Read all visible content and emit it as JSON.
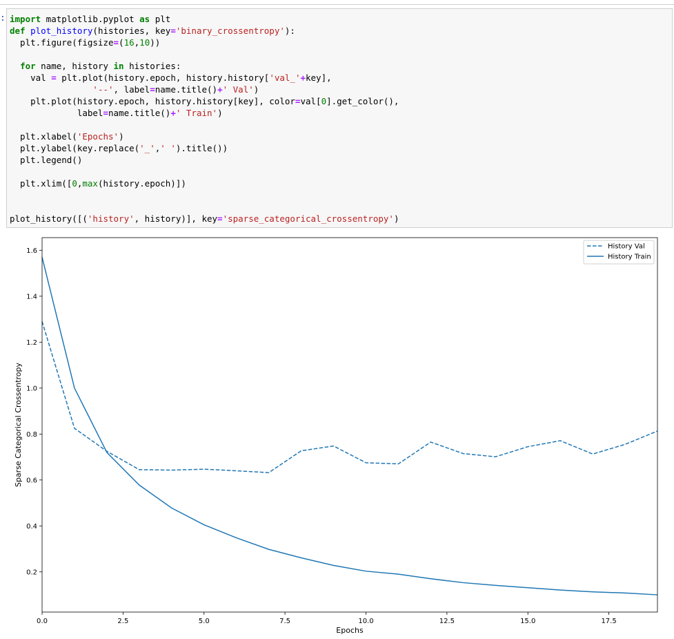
{
  "notebook": {
    "prompt": ":",
    "code_lines": [
      [
        {
          "t": "import",
          "c": "kw"
        },
        {
          "t": " matplotlib.pyplot "
        },
        {
          "t": "as",
          "c": "kw"
        },
        {
          "t": " plt"
        }
      ],
      [
        {
          "t": "def",
          "c": "kw"
        },
        {
          "t": " "
        },
        {
          "t": "plot_history",
          "c": "fn"
        },
        {
          "t": "(histories, key"
        },
        {
          "t": "=",
          "c": "op"
        },
        {
          "t": "'binary_crossentropy'",
          "c": "str"
        },
        {
          "t": "):"
        }
      ],
      [
        {
          "t": "  plt.figure(figsize"
        },
        {
          "t": "=",
          "c": "op"
        },
        {
          "t": "("
        },
        {
          "t": "16",
          "c": "num"
        },
        {
          "t": ","
        },
        {
          "t": "10",
          "c": "num"
        },
        {
          "t": "))"
        }
      ],
      [],
      [
        {
          "t": "  "
        },
        {
          "t": "for",
          "c": "kw"
        },
        {
          "t": " name, history "
        },
        {
          "t": "in",
          "c": "kw"
        },
        {
          "t": " histories:"
        }
      ],
      [
        {
          "t": "    val "
        },
        {
          "t": "=",
          "c": "op"
        },
        {
          "t": " plt.plot(history.epoch, history.history["
        },
        {
          "t": "'val_'",
          "c": "str"
        },
        {
          "t": "+",
          "c": "op"
        },
        {
          "t": "key],"
        }
      ],
      [
        {
          "t": "                "
        },
        {
          "t": "'--'",
          "c": "str"
        },
        {
          "t": ", label"
        },
        {
          "t": "=",
          "c": "op"
        },
        {
          "t": "name.title()"
        },
        {
          "t": "+",
          "c": "op"
        },
        {
          "t": "' Val'",
          "c": "str"
        },
        {
          "t": ")"
        }
      ],
      [
        {
          "t": "    plt.plot(history.epoch, history.history[key], color"
        },
        {
          "t": "=",
          "c": "op"
        },
        {
          "t": "val["
        },
        {
          "t": "0",
          "c": "num"
        },
        {
          "t": "].get_color(),"
        }
      ],
      [
        {
          "t": "             label"
        },
        {
          "t": "=",
          "c": "op"
        },
        {
          "t": "name.title()"
        },
        {
          "t": "+",
          "c": "op"
        },
        {
          "t": "' Train'",
          "c": "str"
        },
        {
          "t": ")"
        }
      ],
      [],
      [
        {
          "t": "  plt.xlabel("
        },
        {
          "t": "'Epochs'",
          "c": "str"
        },
        {
          "t": ")"
        }
      ],
      [
        {
          "t": "  plt.ylabel(key.replace("
        },
        {
          "t": "'_'",
          "c": "str"
        },
        {
          "t": ","
        },
        {
          "t": "' '",
          "c": "str"
        },
        {
          "t": ").title())"
        }
      ],
      [
        {
          "t": "  plt.legend()"
        }
      ],
      [],
      [
        {
          "t": "  plt.xlim(["
        },
        {
          "t": "0",
          "c": "num"
        },
        {
          "t": ","
        },
        {
          "t": "max",
          "c": "num"
        },
        {
          "t": "(history.epoch)])"
        }
      ],
      [],
      [],
      [
        {
          "t": "plot_history([("
        },
        {
          "t": "'history'",
          "c": "str"
        },
        {
          "t": ", history)], key"
        },
        {
          "t": "=",
          "c": "op"
        },
        {
          "t": "'sparse_categorical_crossentropy'",
          "c": "str"
        },
        {
          "t": ")"
        }
      ]
    ]
  },
  "chart_data": {
    "type": "line",
    "xlabel": "Epochs",
    "ylabel": "Sparse Categorical Crossentropy",
    "xlim": [
      0,
      19
    ],
    "ylim": [
      0.025,
      1.655
    ],
    "x_ticks": [
      "0.0",
      "2.5",
      "5.0",
      "7.5",
      "10.0",
      "12.5",
      "15.0",
      "17.5"
    ],
    "x_tick_values": [
      0,
      2.5,
      5,
      7.5,
      10,
      12.5,
      15,
      17.5
    ],
    "y_ticks": [
      "0.2",
      "0.4",
      "0.6",
      "0.8",
      "1.0",
      "1.2",
      "1.4",
      "1.6"
    ],
    "y_tick_values": [
      0.2,
      0.4,
      0.6,
      0.8,
      1.0,
      1.2,
      1.4,
      1.6
    ],
    "legend_position": "top-right",
    "color": "#1f77b4",
    "x": [
      0,
      1,
      2,
      3,
      4,
      5,
      6,
      7,
      8,
      9,
      10,
      11,
      12,
      13,
      14,
      15,
      16,
      17,
      18,
      19
    ],
    "series": [
      {
        "name": "History Val",
        "style": "dashed",
        "values": [
          1.29,
          0.825,
          0.725,
          0.645,
          0.643,
          0.647,
          0.64,
          0.632,
          0.727,
          0.748,
          0.675,
          0.67,
          0.765,
          0.715,
          0.701,
          0.745,
          0.771,
          0.713,
          0.755,
          0.813
        ]
      },
      {
        "name": "History Train",
        "style": "solid",
        "values": [
          1.57,
          1.0,
          0.72,
          0.578,
          0.478,
          0.405,
          0.348,
          0.298,
          0.261,
          0.228,
          0.203,
          0.19,
          0.17,
          0.153,
          0.141,
          0.131,
          0.121,
          0.113,
          0.108,
          0.1
        ]
      }
    ]
  }
}
